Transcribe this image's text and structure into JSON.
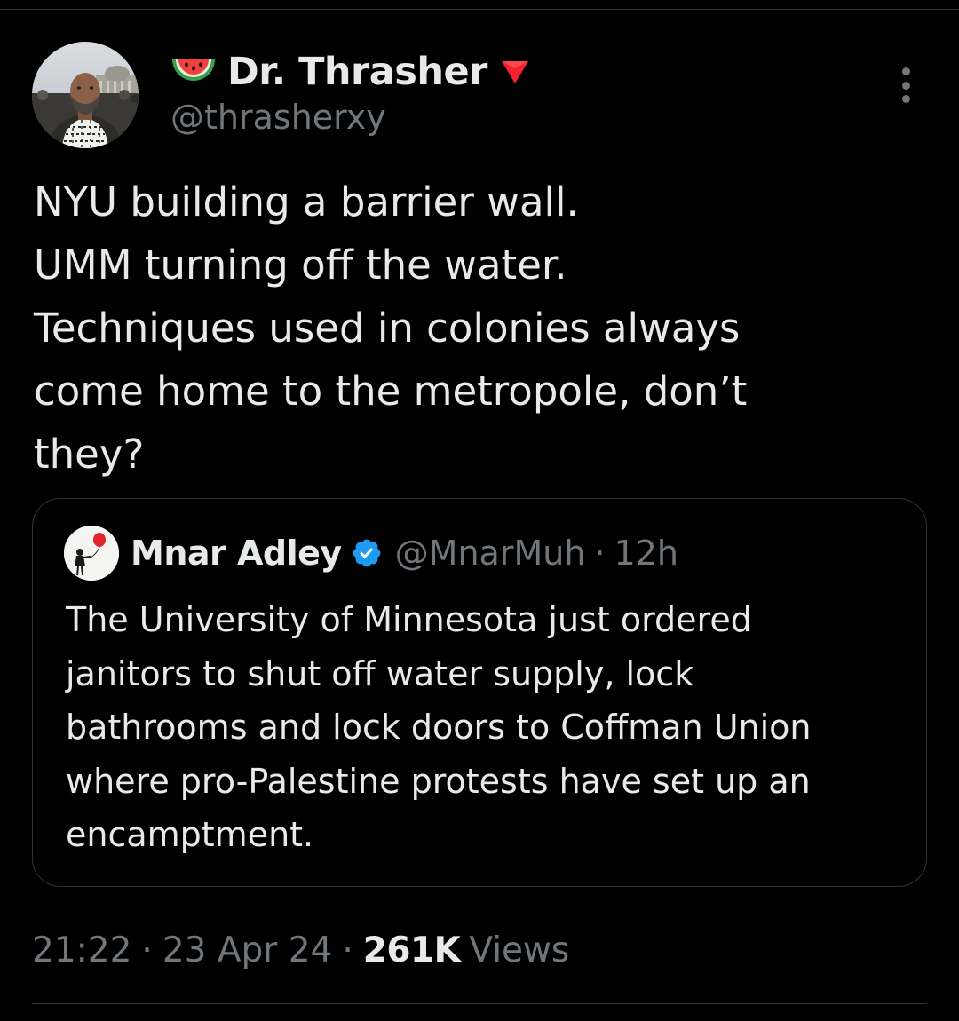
{
  "author": {
    "name": "Dr. Thrasher",
    "handle": "@thrasherxy",
    "name_prefix_icon": "watermelon-icon",
    "name_suffix_icon": "red-triangle-icon"
  },
  "tweet": {
    "lines": [
      "NYU building a barrier wall.",
      "UMM turning off the water.",
      "Techniques used in colonies always",
      "come home to the metropole, don’t",
      "they?"
    ]
  },
  "quote": {
    "name": "Mnar Adley",
    "verified_icon": "verified-badge-icon",
    "handle": "@MnarMuh",
    "separator": "·",
    "time": "12h",
    "lines": [
      "The University of Minnesota just ordered",
      "janitors to shut off water supply, lock",
      "bathrooms and lock doors to Coffman Union",
      "where pro-Palestine protests have set up an",
      "encamptment."
    ]
  },
  "meta": {
    "time": "21:22",
    "separator": "·",
    "date": "23 Apr 24",
    "views_count": "261K",
    "views_label": "Views"
  },
  "colors": {
    "background": "#000000",
    "text_primary": "#e7e9ea",
    "text_secondary": "#71767b",
    "border": "#2f3336",
    "verified": "#1d9bf0",
    "triangle": "#f4212e"
  }
}
